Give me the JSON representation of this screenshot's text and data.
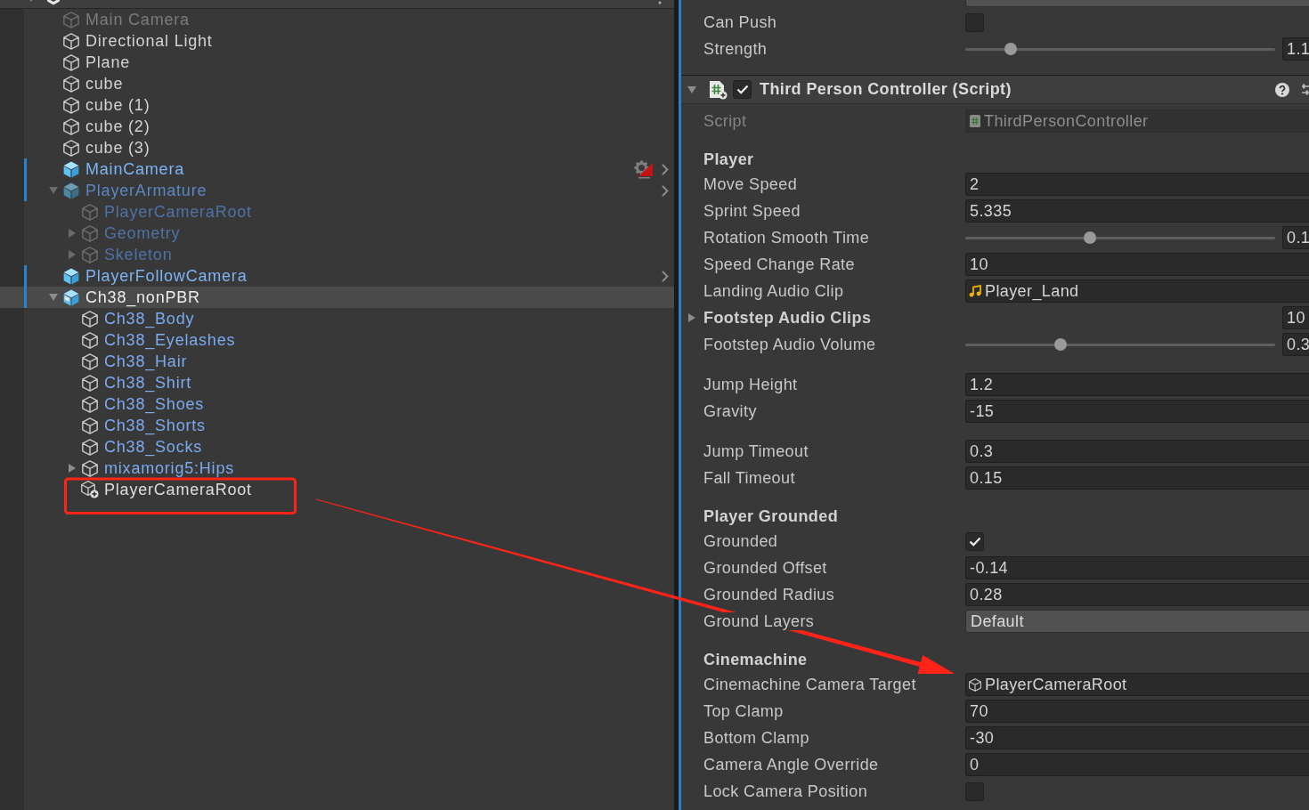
{
  "hierarchy": {
    "scene": {
      "expanded": true
    },
    "items": [
      {
        "name": "Main Camera",
        "kind": "object",
        "active": false,
        "selected": false
      },
      {
        "name": "Directional Light",
        "kind": "object",
        "active": true,
        "selected": false
      },
      {
        "name": "Plane",
        "kind": "object",
        "active": true,
        "selected": false
      },
      {
        "name": "cube",
        "kind": "object",
        "active": true,
        "selected": false
      },
      {
        "name": "cube (1)",
        "kind": "object",
        "active": true,
        "selected": false
      },
      {
        "name": "cube (2)",
        "kind": "object",
        "active": true,
        "selected": false
      },
      {
        "name": "cube (3)",
        "kind": "object",
        "active": true,
        "selected": false
      },
      {
        "name": "MainCamera",
        "kind": "prefab",
        "active": true,
        "selected": false,
        "badge": true
      },
      {
        "name": "PlayerArmature",
        "kind": "prefab",
        "active": false,
        "selected": false,
        "badge": false,
        "expanded": true,
        "children": [
          {
            "name": "PlayerCameraRoot",
            "kind": "prefab_part",
            "active": false,
            "selected": false
          },
          {
            "name": "Geometry",
            "kind": "prefab_part",
            "active": false,
            "selected": false,
            "expanded": false
          },
          {
            "name": "Skeleton",
            "kind": "prefab_part",
            "active": false,
            "selected": false,
            "expanded": false
          }
        ]
      },
      {
        "name": "PlayerFollowCamera",
        "kind": "prefab",
        "active": true,
        "selected": false,
        "badge": false
      },
      {
        "name": "Ch38_nonPBR",
        "kind": "model",
        "active": true,
        "selected": true,
        "expanded": true,
        "children": [
          {
            "name": "Ch38_Body",
            "kind": "prefab_part",
            "active": true,
            "selected": false
          },
          {
            "name": "Ch38_Eyelashes",
            "kind": "prefab_part",
            "active": true,
            "selected": false
          },
          {
            "name": "Ch38_Hair",
            "kind": "prefab_part",
            "active": true,
            "selected": false
          },
          {
            "name": "Ch38_Shirt",
            "kind": "prefab_part",
            "active": true,
            "selected": false
          },
          {
            "name": "Ch38_Shoes",
            "kind": "prefab_part",
            "active": true,
            "selected": false
          },
          {
            "name": "Ch38_Shorts",
            "kind": "prefab_part",
            "active": true,
            "selected": false
          },
          {
            "name": "Ch38_Socks",
            "kind": "prefab_part",
            "active": true,
            "selected": false
          },
          {
            "name": "mixamorig5:Hips",
            "kind": "prefab_part",
            "active": true,
            "selected": false,
            "expanded": false
          },
          {
            "name": "PlayerCameraRoot",
            "kind": "added",
            "active": true,
            "selected": false
          }
        ]
      }
    ]
  },
  "inspector": {
    "previous_component": {
      "fields": [
        {
          "kind": "dropdown"
        },
        {
          "label": "Can Push",
          "kind": "checkbox",
          "checked": false
        },
        {
          "label": "Strength",
          "kind": "slider",
          "level": 0.147,
          "value": "1.1"
        }
      ]
    },
    "component": {
      "title": "Third Person Controller (Script)",
      "expanded": true,
      "enabled": true,
      "script": {
        "label": "Script",
        "value": "ThirdPersonController",
        "disabled": true
      },
      "groups": [
        {
          "header": "Player",
          "fields": [
            {
              "label": "Move Speed",
              "kind": "number",
              "value": "2"
            },
            {
              "label": "Sprint Speed",
              "kind": "number",
              "value": "5.335"
            },
            {
              "label": "Rotation Smooth Time",
              "kind": "slider",
              "level": 0.402,
              "value": "0.1"
            },
            {
              "label": "Speed Change Rate",
              "kind": "number",
              "value": "10"
            },
            {
              "label": "Landing Audio Clip",
              "kind": "audio_clip",
              "value": "Player_Land"
            },
            {
              "label": "Footstep Audio Clips",
              "kind": "array",
              "expanded": false,
              "value": "10"
            },
            {
              "label": "Footstep Audio Volume",
              "kind": "slider",
              "level": 0.307,
              "value": "0.3"
            }
          ]
        },
        {
          "fields": [
            {
              "label": "Jump Height",
              "kind": "number",
              "value": "1.2"
            },
            {
              "label": "Gravity",
              "kind": "number",
              "value": "-15"
            }
          ]
        },
        {
          "fields": [
            {
              "label": "Jump Timeout",
              "kind": "number",
              "value": "0.3"
            },
            {
              "label": "Fall Timeout",
              "kind": "number",
              "value": "0.15"
            }
          ]
        },
        {
          "header": "Player Grounded",
          "fields": [
            {
              "label": "Grounded",
              "kind": "checkbox",
              "checked": true
            },
            {
              "label": "Grounded Offset",
              "kind": "number",
              "value": "-0.14"
            },
            {
              "label": "Grounded Radius",
              "kind": "number",
              "value": "0.28"
            },
            {
              "label": "Ground Layers",
              "kind": "dropdown",
              "value": "Default"
            }
          ]
        },
        {
          "header": "Cinemachine",
          "fields": [
            {
              "label": "Cinemachine Camera Target",
              "kind": "game_object",
              "value": "PlayerCameraRoot"
            },
            {
              "label": "Top Clamp",
              "kind": "number",
              "value": "70"
            },
            {
              "label": "Bottom Clamp",
              "kind": "number",
              "value": "-30"
            },
            {
              "label": "Camera Angle Override",
              "kind": "number",
              "value": "0"
            },
            {
              "label": "Lock Camera Position",
              "kind": "checkbox",
              "checked": false
            }
          ]
        }
      ]
    }
  }
}
